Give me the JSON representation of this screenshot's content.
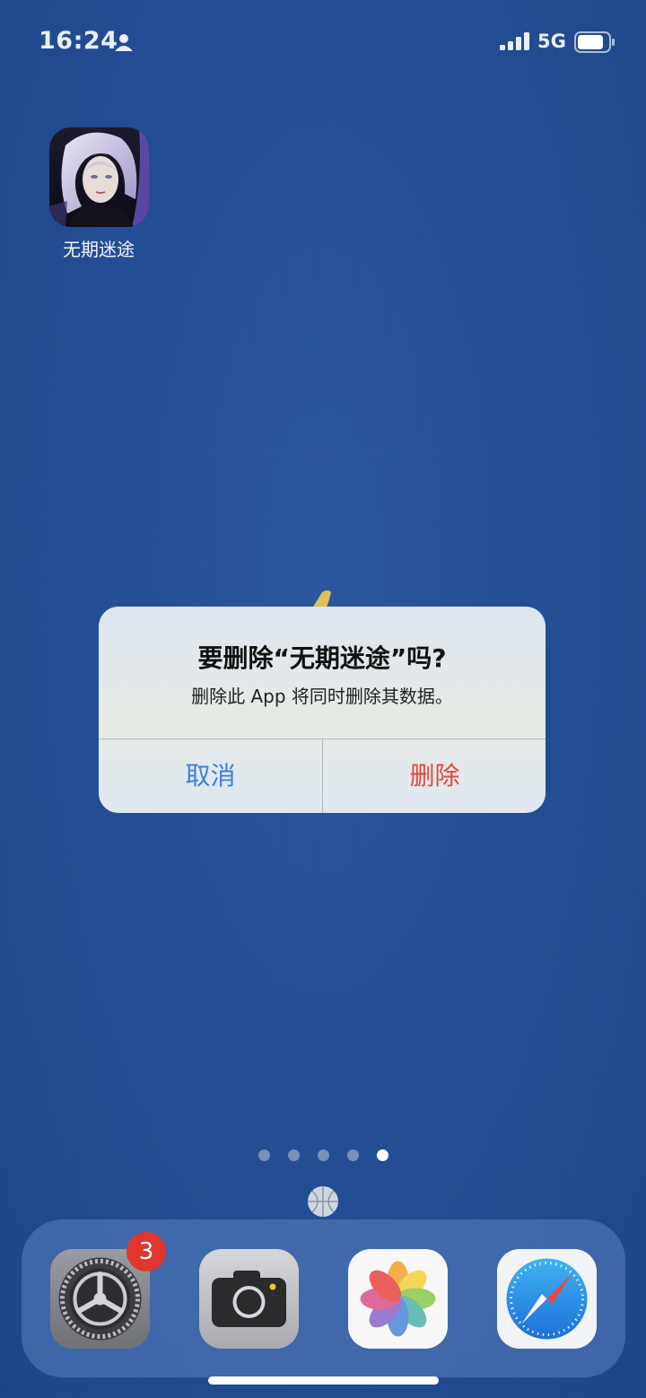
{
  "status_bar": {
    "time": "16:24",
    "network": "5G",
    "icons": [
      "person-icon",
      "signal-icon",
      "battery-icon"
    ]
  },
  "home": {
    "apps": [
      {
        "label": "无期迷途",
        "icon": "game-character-icon"
      }
    ],
    "page_dots": {
      "count": 5,
      "active_index": 4
    }
  },
  "dialog": {
    "title": "要删除“无期迷途”吗?",
    "message": "删除此 App 将同时删除其数据。",
    "cancel_label": "取消",
    "delete_label": "删除"
  },
  "dock": {
    "apps": [
      {
        "name": "Settings",
        "icon": "settings-gear-icon",
        "badge": "3"
      },
      {
        "name": "Camera",
        "icon": "camera-icon"
      },
      {
        "name": "Photos",
        "icon": "photos-flower-icon"
      },
      {
        "name": "Safari",
        "icon": "safari-compass-icon"
      }
    ]
  },
  "colors": {
    "wallpaper": "#244f96",
    "cancel": "#3a7de0",
    "destructive": "#e5463b",
    "badge": "#e0362e"
  }
}
